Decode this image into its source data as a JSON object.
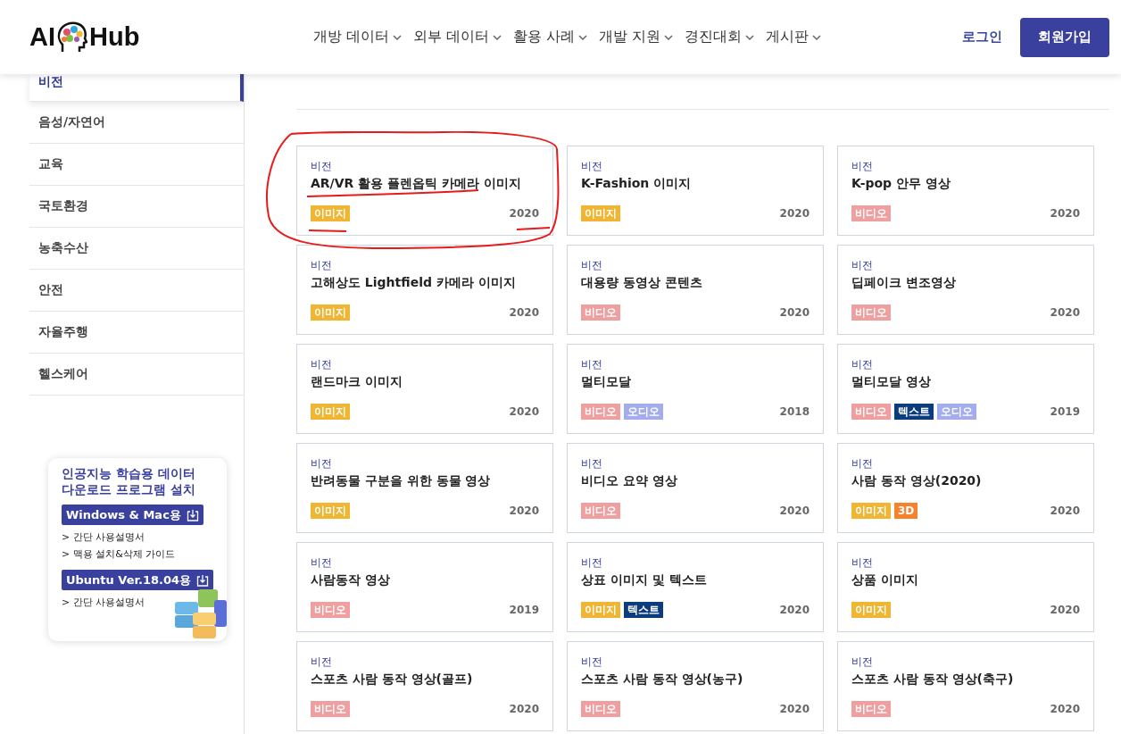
{
  "header": {
    "logo": {
      "left": "AI",
      "right": "Hub"
    },
    "nav": [
      {
        "label": "개방 데이터"
      },
      {
        "label": "외부 데이터"
      },
      {
        "label": "활용 사례"
      },
      {
        "label": "개발 지원"
      },
      {
        "label": "경진대회"
      },
      {
        "label": "게시판"
      }
    ],
    "login": "로그인",
    "signup": "회원가입"
  },
  "sidebar": {
    "items": [
      {
        "label": "비전",
        "selected": true
      },
      {
        "label": "음성/자연어",
        "selected": false
      },
      {
        "label": "교육",
        "selected": false
      },
      {
        "label": "국토환경",
        "selected": false
      },
      {
        "label": "농축수산",
        "selected": false
      },
      {
        "label": "안전",
        "selected": false
      },
      {
        "label": "자율주행",
        "selected": false
      },
      {
        "label": "헬스케어",
        "selected": false
      }
    ]
  },
  "download_box": {
    "title": "인공지능 학습용 데이터 다운로드 프로그램 설치",
    "sections": [
      {
        "button": "Windows & Mac용",
        "links": [
          "> 간단 사용설명서",
          "> 맥용 설치&삭제 가이드"
        ]
      },
      {
        "button": "Ubuntu Ver.18.04용",
        "links": [
          "> 간단 사용설명서"
        ]
      }
    ]
  },
  "cards": [
    {
      "category": "비전",
      "title": "AR/VR 활용 플렌옵틱 카메라 이미지",
      "tags": [
        {
          "label": "이미지",
          "color": "#f0b633"
        }
      ],
      "year": "2020",
      "circled": true
    },
    {
      "category": "비전",
      "title": "K-Fashion 이미지",
      "tags": [
        {
          "label": "이미지",
          "color": "#f0b633"
        }
      ],
      "year": "2020",
      "circled": false
    },
    {
      "category": "비전",
      "title": "K-pop 안무 영상",
      "tags": [
        {
          "label": "비디오",
          "color": "#ef9f9f"
        }
      ],
      "year": "2020",
      "circled": false
    },
    {
      "category": "비전",
      "title": "고해상도 Lightfield 카메라 이미지",
      "tags": [
        {
          "label": "이미지",
          "color": "#f0b633"
        }
      ],
      "year": "2020",
      "circled": false
    },
    {
      "category": "비전",
      "title": "대용량 동영상 콘텐츠",
      "tags": [
        {
          "label": "비디오",
          "color": "#ef9f9f"
        }
      ],
      "year": "2020",
      "circled": false
    },
    {
      "category": "비전",
      "title": "딥페이크 변조영상",
      "tags": [
        {
          "label": "비디오",
          "color": "#ef9f9f"
        }
      ],
      "year": "2020",
      "circled": false
    },
    {
      "category": "비전",
      "title": "랜드마크 이미지",
      "tags": [
        {
          "label": "이미지",
          "color": "#f0b633"
        }
      ],
      "year": "2020",
      "circled": false
    },
    {
      "category": "비전",
      "title": "멀티모달",
      "tags": [
        {
          "label": "비디오",
          "color": "#ef9f9f"
        },
        {
          "label": "오디오",
          "color": "#a3acec"
        }
      ],
      "year": "2018",
      "circled": false
    },
    {
      "category": "비전",
      "title": "멀티모달 영상",
      "tags": [
        {
          "label": "비디오",
          "color": "#ef9f9f"
        },
        {
          "label": "텍스트",
          "color": "#0b3c7d"
        },
        {
          "label": "오디오",
          "color": "#a3acec"
        }
      ],
      "year": "2019",
      "circled": false
    },
    {
      "category": "비전",
      "title": "반려동물 구분을 위한 동물 영상",
      "tags": [
        {
          "label": "이미지",
          "color": "#f0b633"
        }
      ],
      "year": "2020",
      "circled": false
    },
    {
      "category": "비전",
      "title": "비디오 요약 영상",
      "tags": [
        {
          "label": "비디오",
          "color": "#ef9f9f"
        }
      ],
      "year": "2020",
      "circled": false
    },
    {
      "category": "비전",
      "title": "사람 동작 영상(2020)",
      "tags": [
        {
          "label": "이미지",
          "color": "#f0b633"
        },
        {
          "label": "3D",
          "color": "#f7822e"
        }
      ],
      "year": "2020",
      "circled": false
    },
    {
      "category": "비전",
      "title": "사람동작 영상",
      "tags": [
        {
          "label": "비디오",
          "color": "#ef9f9f"
        }
      ],
      "year": "2019",
      "circled": false
    },
    {
      "category": "비전",
      "title": "상표 이미지 및 텍스트",
      "tags": [
        {
          "label": "이미지",
          "color": "#f0b633"
        },
        {
          "label": "텍스트",
          "color": "#0b3c7d"
        }
      ],
      "year": "2020",
      "circled": false
    },
    {
      "category": "비전",
      "title": "상품 이미지",
      "tags": [
        {
          "label": "이미지",
          "color": "#f0b633"
        }
      ],
      "year": "2020",
      "circled": false
    },
    {
      "category": "비전",
      "title": "스포츠 사람 동작 영상(골프)",
      "tags": [
        {
          "label": "비디오",
          "color": "#ef9f9f"
        }
      ],
      "year": "2020",
      "circled": false
    },
    {
      "category": "비전",
      "title": "스포츠 사람 동작 영상(농구)",
      "tags": [
        {
          "label": "비디오",
          "color": "#ef9f9f"
        }
      ],
      "year": "2020",
      "circled": false
    },
    {
      "category": "비전",
      "title": "스포츠 사람 동작 영상(축구)",
      "tags": [
        {
          "label": "비디오",
          "color": "#ef9f9f"
        }
      ],
      "year": "2020",
      "circled": false
    }
  ]
}
